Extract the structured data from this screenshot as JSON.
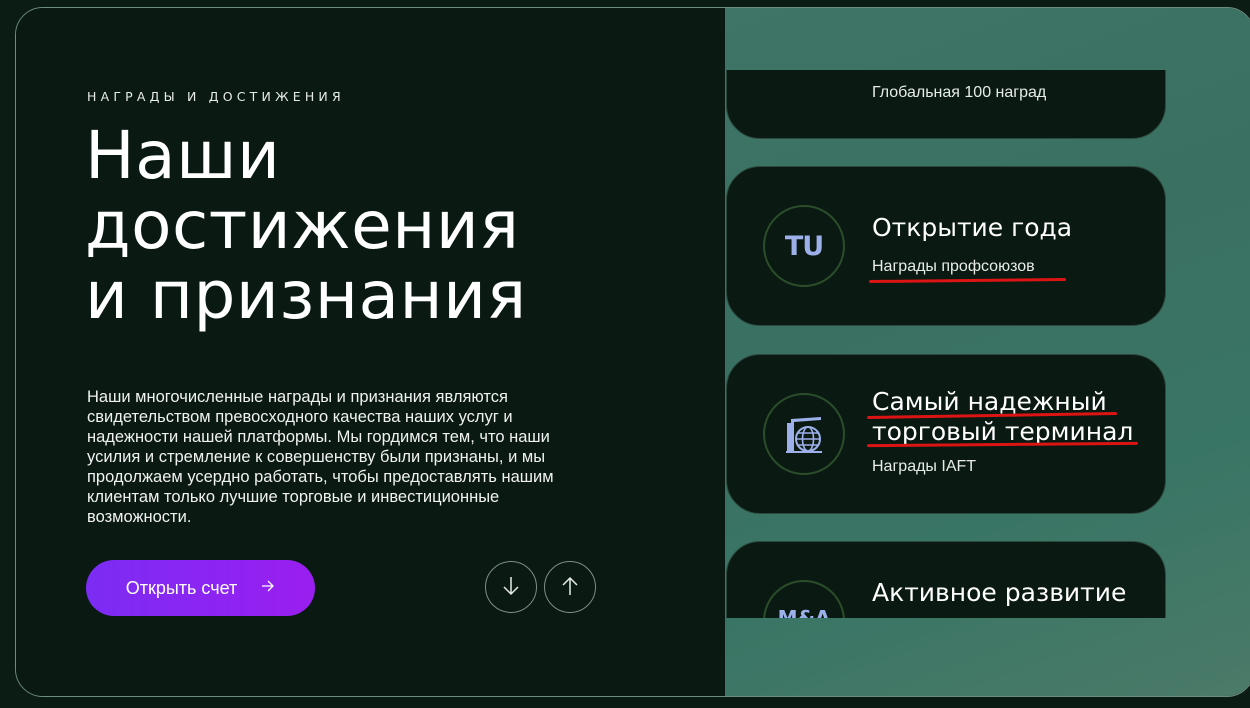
{
  "hero": {
    "eyebrow": "НАГРАДЫ И ДОСТИЖЕНИЯ",
    "title_lines": [
      "Наши",
      "достижения",
      "и признания"
    ],
    "description": "Наши многочисленные награды и признания являются свидетельством превосходного качества наших услуг и надежности нашей платформы. Мы гордимся тем, что наши усилия и стремление к совершенству были признаны, и мы продолжаем усердно работать, чтобы предоставлять нашим клиентам только лучшие торговые и инвестиционные возможности.",
    "cta_label": "Открыть счет",
    "cta_icon": "arrow-right-icon"
  },
  "carousel": {
    "down_icon": "arrow-down-icon",
    "up_icon": "arrow-up-icon"
  },
  "awards": [
    {
      "title": "",
      "subtitle": "Глобальная 100 наград",
      "icon": "award-logo-icon"
    },
    {
      "title": "Открытие года",
      "subtitle": "Награды профсоюзов",
      "icon": "tu-logo-icon",
      "badge_text": "TU"
    },
    {
      "title_lines": [
        "Самый надежный",
        "торговый терминал"
      ],
      "subtitle": "Награды IAFT",
      "icon": "iaft-globe-icon"
    },
    {
      "title": "Активное развитие",
      "subtitle": "",
      "icon": "ma-logo-icon",
      "badge_text": "M&A"
    }
  ],
  "colors": {
    "background": "#0a1a12",
    "right_panel": "#3a7062",
    "cta_start": "#7b2cf3",
    "cta_end": "#9a1ef0",
    "logo_blue": "#9db0ea",
    "annotation_red": "#dc1414"
  }
}
